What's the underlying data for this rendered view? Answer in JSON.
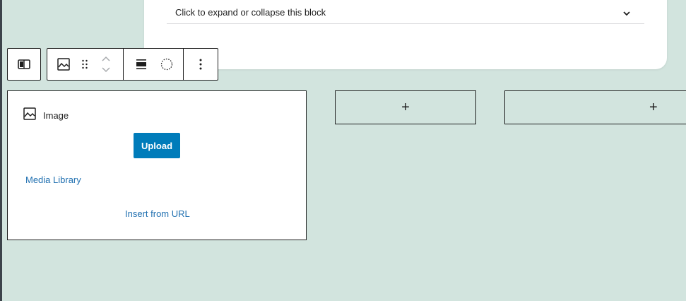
{
  "card": {
    "expand_label": "Click to expand or collapse this block",
    "expand_icon": "chevron-down-icon"
  },
  "toolbar": {
    "parent_icon": "columns-icon",
    "buttons": [
      {
        "name": "image-block-icon"
      },
      {
        "name": "drag-handle-icon"
      },
      {
        "name": "move-up-icon"
      },
      {
        "name": "move-down-icon"
      },
      {
        "name": "align-wide-icon"
      },
      {
        "name": "circle-dashed-icon"
      },
      {
        "name": "more-options-icon"
      }
    ]
  },
  "image_block": {
    "title": "Image",
    "icon": "image-icon",
    "upload_label": "Upload",
    "media_library_label": "Media Library",
    "insert_url_label": "Insert from URL"
  },
  "appenders": [
    {
      "symbol": "+"
    },
    {
      "symbol": "+"
    }
  ],
  "colors": {
    "background": "#d2e4de",
    "primary": "#007cba",
    "link": "#2271b1",
    "border": "#1e1e1e"
  }
}
